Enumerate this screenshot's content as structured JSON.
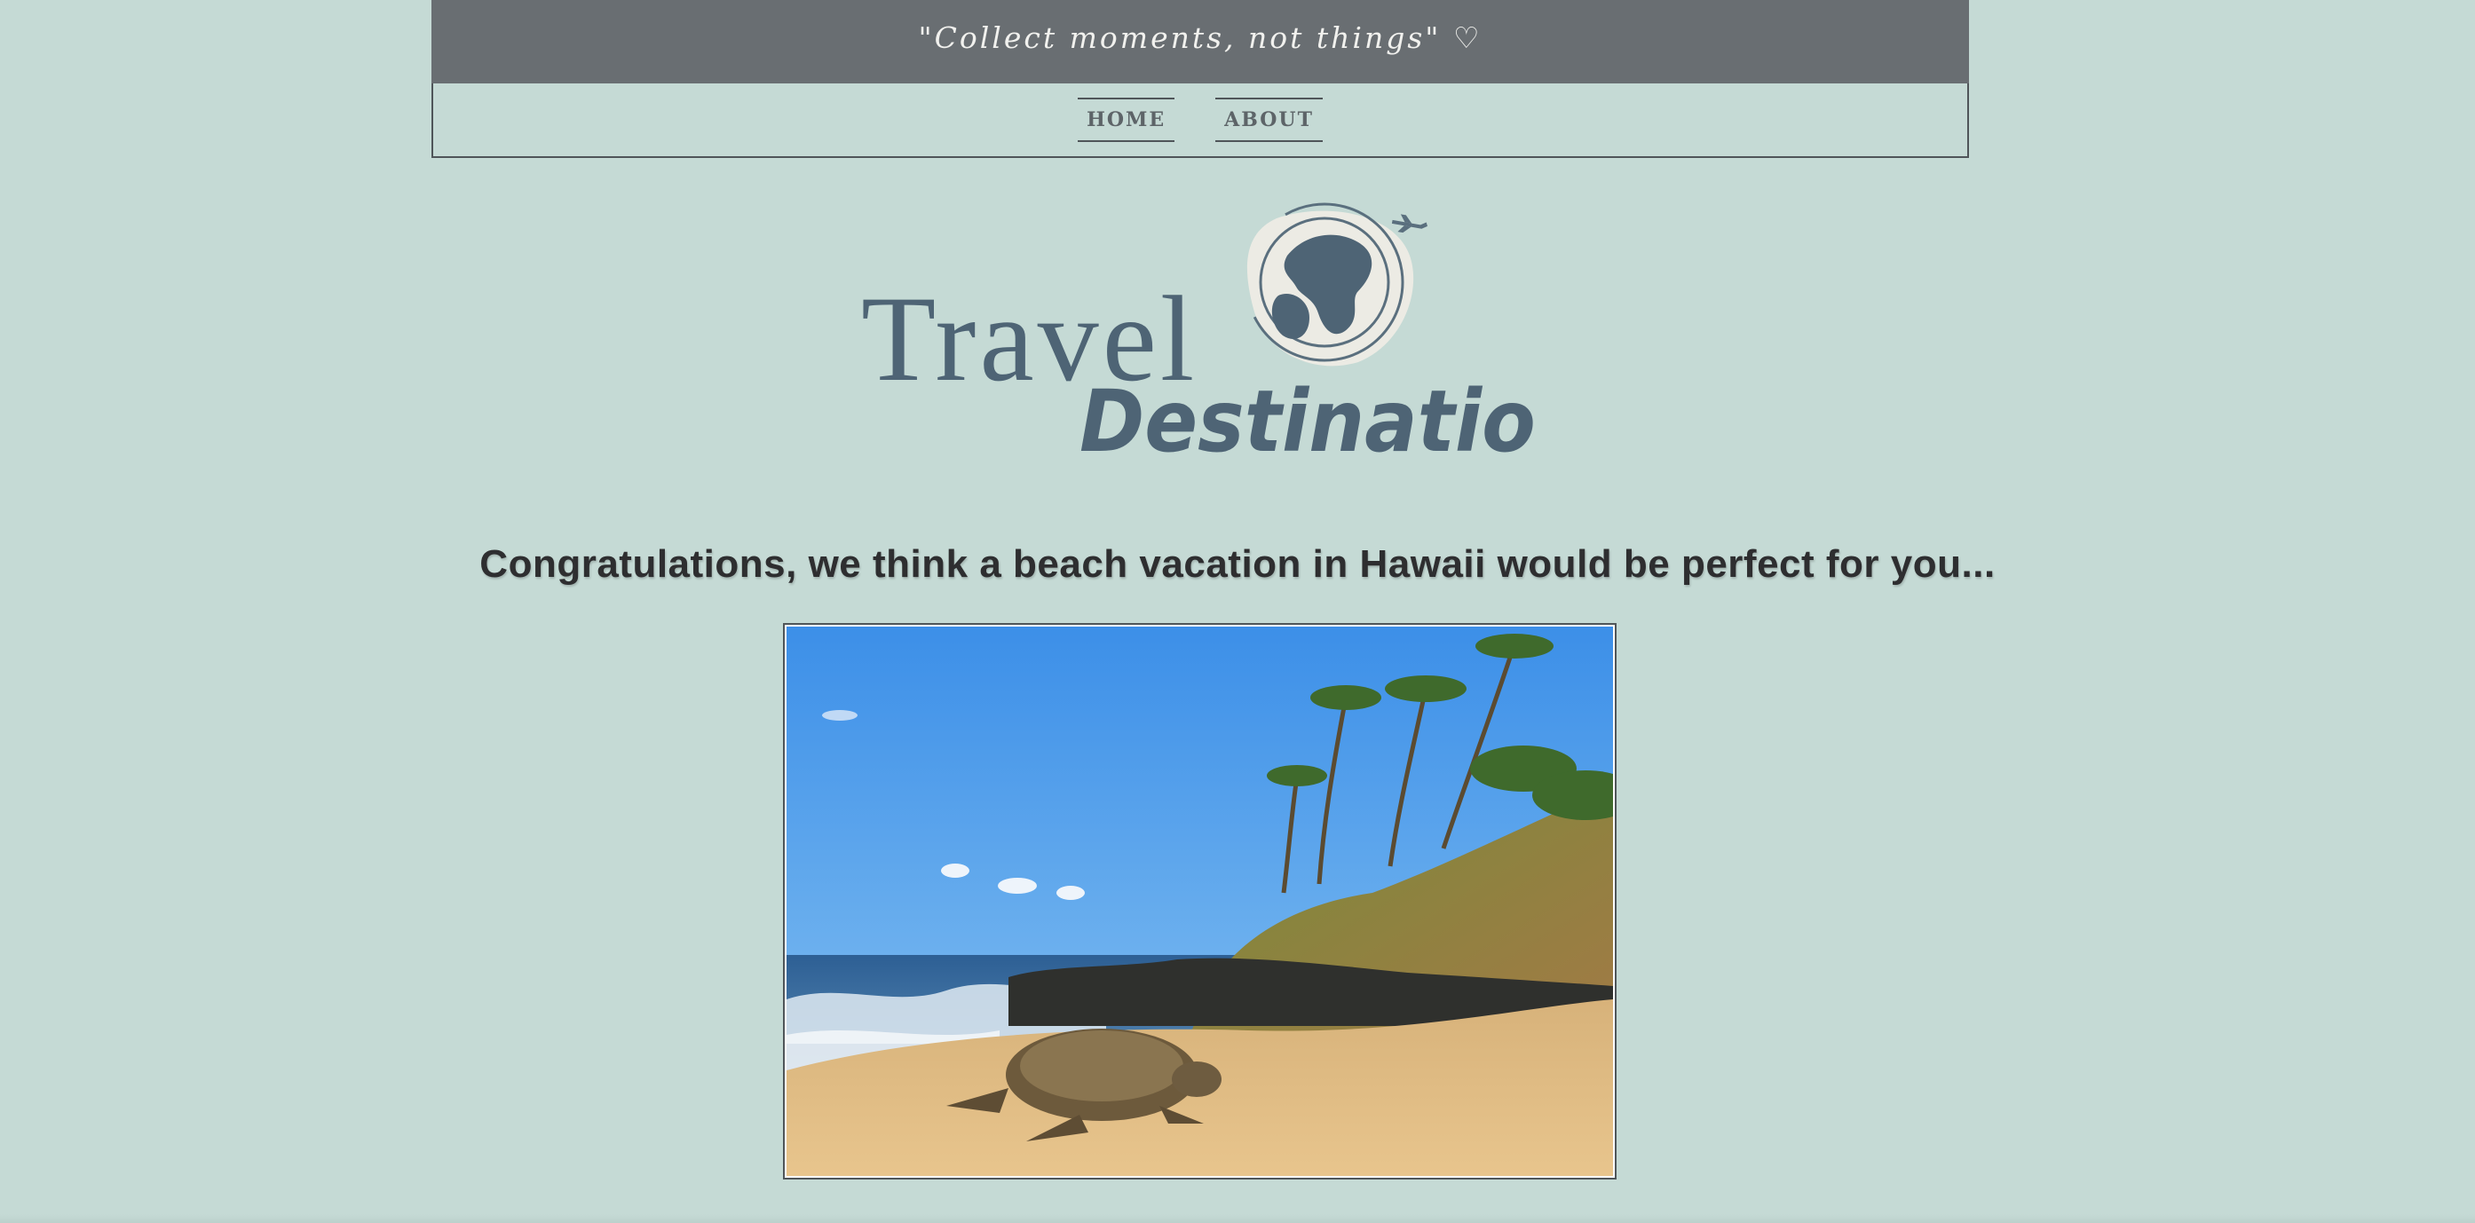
{
  "header": {
    "tagline": "\"Collect moments, not things\" ♡"
  },
  "nav": {
    "items": [
      {
        "label": "HOME"
      },
      {
        "label": "ABOUT"
      }
    ]
  },
  "logo": {
    "word1": "Travel",
    "word2": "Destination"
  },
  "main": {
    "headline": "Congratulations, we think a beach vacation in Hawaii would be perfect for you..."
  },
  "colors": {
    "background": "#c5dad5",
    "banner": "#696e72",
    "logo_navy": "#4e6475"
  }
}
